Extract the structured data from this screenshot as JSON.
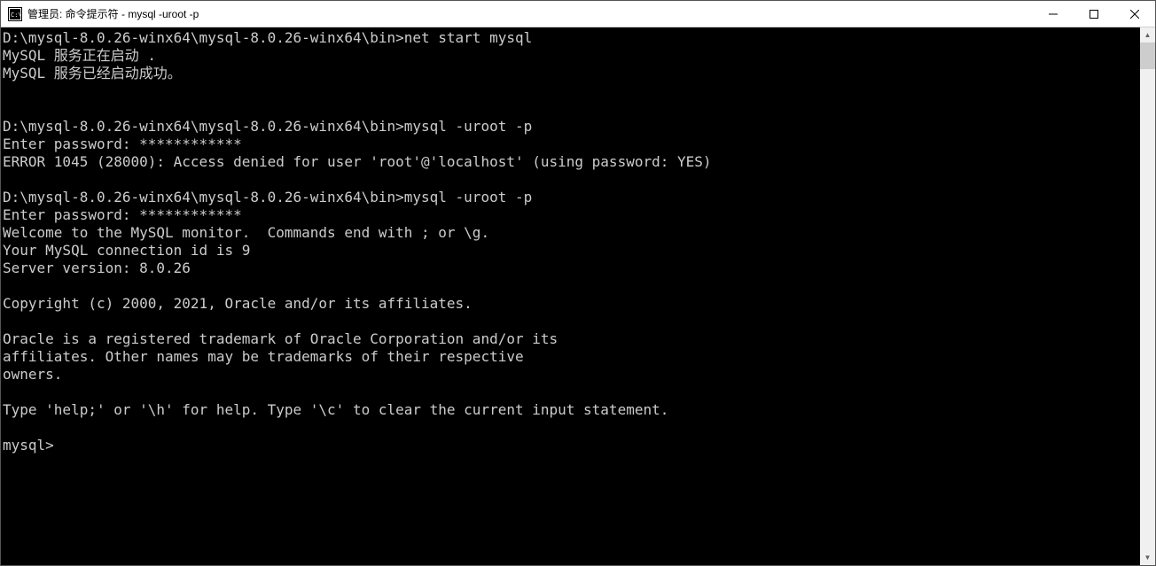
{
  "window": {
    "title": "管理员: 命令提示符 - mysql  -uroot -p"
  },
  "icons": {
    "cmd": "C:\\",
    "minimize": "—",
    "maximize": "□",
    "close": "✕",
    "scroll_up": "▲",
    "scroll_down": "▼"
  },
  "console": {
    "lines": [
      "D:\\mysql-8.0.26-winx64\\mysql-8.0.26-winx64\\bin>net start mysql",
      "MySQL 服务正在启动 .",
      "MySQL 服务已经启动成功。",
      "",
      "",
      "D:\\mysql-8.0.26-winx64\\mysql-8.0.26-winx64\\bin>mysql -uroot -p",
      "Enter password: ************",
      "ERROR 1045 (28000): Access denied for user 'root'@'localhost' (using password: YES)",
      "",
      "D:\\mysql-8.0.26-winx64\\mysql-8.0.26-winx64\\bin>mysql -uroot -p",
      "Enter password: ************",
      "Welcome to the MySQL monitor.  Commands end with ; or \\g.",
      "Your MySQL connection id is 9",
      "Server version: 8.0.26",
      "",
      "Copyright (c) 2000, 2021, Oracle and/or its affiliates.",
      "",
      "Oracle is a registered trademark of Oracle Corporation and/or its",
      "affiliates. Other names may be trademarks of their respective",
      "owners.",
      "",
      "Type 'help;' or '\\h' for help. Type '\\c' to clear the current input statement.",
      "",
      "mysql>"
    ]
  }
}
